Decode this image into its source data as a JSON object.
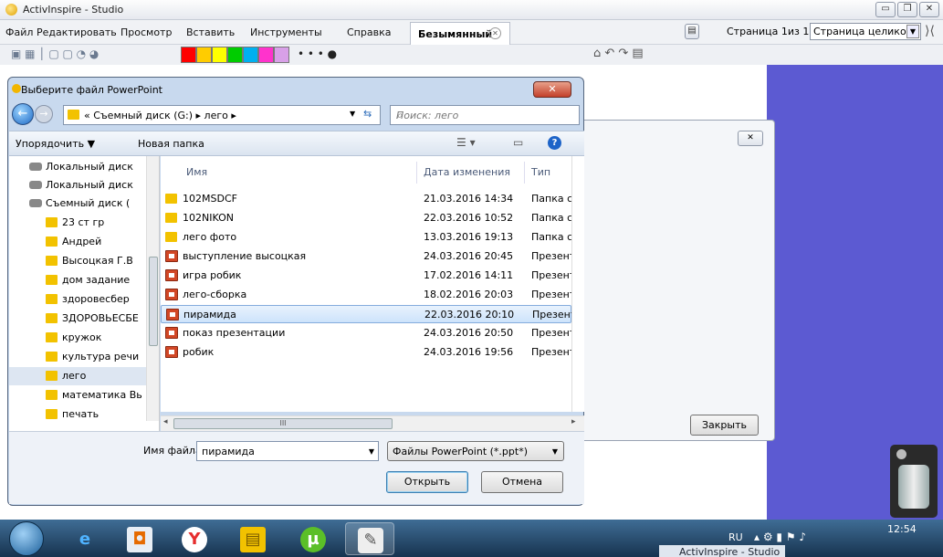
{
  "app": {
    "title": "ActivInspire - Studio",
    "menus": [
      "Файл",
      "Редактировать",
      "Просмотр",
      "Вставить",
      "Инструменты",
      "Справка"
    ],
    "doc_tab": "Безымянный",
    "page_counter": "Страница 1из 1",
    "page_view": "Страница целиком"
  },
  "toolbar": {
    "colors": [
      "#ff0000",
      "#ffcc00",
      "#ffff00",
      "#00cc00",
      "#00b0f0",
      "#ff33cc",
      "#d8a0e8",
      "#ffe4e4",
      "#cc0000"
    ]
  },
  "background_dialog": {
    "close_label": "Закрыть",
    "link_fragment": "а'"
  },
  "dialog": {
    "title": "Выберите файл PowerPoint",
    "close_glyph": "✕",
    "breadcrumb": "« Съемный диск (G:) ▸ лего ▸",
    "search_placeholder": "Поиск: лего",
    "organize_label": "Упорядочить ▼",
    "new_folder_label": "Новая папка",
    "tree": [
      {
        "label": "Локальный диск",
        "kind": "disk"
      },
      {
        "label": "Локальный диск",
        "kind": "disk"
      },
      {
        "label": "Съемный диск (",
        "kind": "disk"
      },
      {
        "label": "23 ст гр",
        "kind": "folder"
      },
      {
        "label": "Андрей",
        "kind": "folder"
      },
      {
        "label": "Высоцкая Г.В",
        "kind": "folder"
      },
      {
        "label": "дом задание",
        "kind": "folder"
      },
      {
        "label": "здоровесбер",
        "kind": "folder"
      },
      {
        "label": "ЗДОРОВЬЕСБЕ",
        "kind": "folder"
      },
      {
        "label": "кружок",
        "kind": "folder"
      },
      {
        "label": "культура речи",
        "kind": "folder"
      },
      {
        "label": "лего",
        "kind": "folder"
      },
      {
        "label": "математика Вь",
        "kind": "folder"
      },
      {
        "label": "печать",
        "kind": "folder"
      }
    ],
    "columns": {
      "name": "Имя",
      "date": "Дата изменения",
      "type": "Тип"
    },
    "files": [
      {
        "name": "102MSDCF",
        "date": "21.03.2016 14:34",
        "type": "Папка с ф",
        "kind": "folder"
      },
      {
        "name": "102NIKON",
        "date": "22.03.2016 10:52",
        "type": "Папка с ф",
        "kind": "folder"
      },
      {
        "name": "лего фото",
        "date": "13.03.2016 19:13",
        "type": "Папка с ф",
        "kind": "folder"
      },
      {
        "name": "выступление высоцкая",
        "date": "24.03.2016 20:45",
        "type": "Презента",
        "kind": "ppt"
      },
      {
        "name": "игра робик",
        "date": "17.02.2016 14:11",
        "type": "Презента",
        "kind": "ppt"
      },
      {
        "name": "лего-сборка",
        "date": "18.02.2016 20:03",
        "type": "Презента",
        "kind": "ppt"
      },
      {
        "name": "пирамида",
        "date": "22.03.2016 20:10",
        "type": "Презента",
        "kind": "ppt"
      },
      {
        "name": "показ презентации",
        "date": "24.03.2016 20:50",
        "type": "Презента",
        "kind": "ppt"
      },
      {
        "name": "робик",
        "date": "24.03.2016 19:56",
        "type": "Презента",
        "kind": "ppt"
      }
    ],
    "filename_label": "Имя файла:",
    "filename_value": "пирамида",
    "filetype_value": "Файлы PowerPoint (*.ppt*)",
    "open_label": "Открыть",
    "cancel_label": "Отмена",
    "hscroll_grip": "III"
  },
  "taskbar": {
    "lang": "RU",
    "time": "12:54",
    "ghost_title": "ActivInspire - Studio"
  }
}
